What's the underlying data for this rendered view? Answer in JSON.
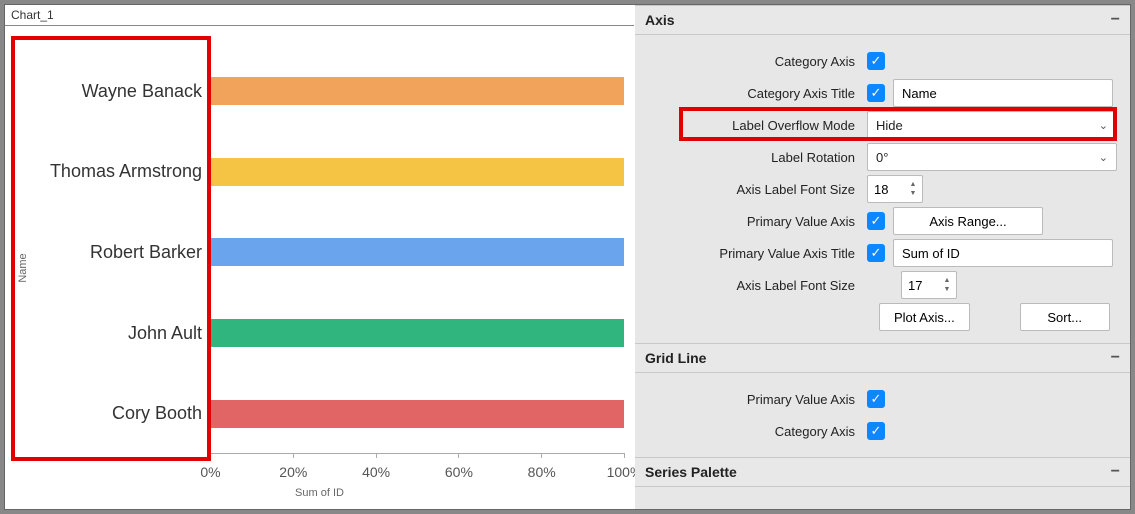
{
  "chart_tab": "Chart_1",
  "chart_data": {
    "type": "bar",
    "orientation": "horizontal",
    "categories": [
      "Wayne Banack",
      "Thomas Armstrong",
      "Robert Barker",
      "John Ault",
      "Cory Booth"
    ],
    "values": [
      100,
      100,
      100,
      100,
      100
    ],
    "colors": [
      "#f1a35c",
      "#f6c445",
      "#6aa4ec",
      "#2fb57d",
      "#e26565"
    ],
    "xlabel": "Sum of ID",
    "ylabel": "Name",
    "xticks": [
      "0%",
      "20%",
      "40%",
      "60%",
      "80%",
      "100%"
    ],
    "xlim": [
      0,
      100
    ]
  },
  "panel": {
    "axis": {
      "title": "Axis",
      "category_axis_label": "Category Axis",
      "category_axis_title_label": "Category Axis Title",
      "category_axis_title_value": "Name",
      "label_overflow_label": "Label Overflow Mode",
      "label_overflow_value": "Hide",
      "label_rotation_label": "Label Rotation",
      "label_rotation_value": "0°",
      "axis_label_font_size_label": "Axis Label Font Size",
      "axis_label_font_size_value": "18",
      "primary_value_axis_label": "Primary Value Axis",
      "axis_range_btn": "Axis Range...",
      "primary_value_axis_title_label": "Primary Value Axis Title",
      "primary_value_axis_title_value": "Sum of ID",
      "axis_label_font_size2_label": "Axis Label Font Size",
      "axis_label_font_size2_value": "17",
      "plot_axis_btn": "Plot Axis...",
      "sort_btn": "Sort..."
    },
    "gridline": {
      "title": "Grid Line",
      "primary_value_axis_label": "Primary Value Axis",
      "category_axis_label": "Category Axis"
    },
    "series_palette": {
      "title": "Series Palette"
    }
  }
}
